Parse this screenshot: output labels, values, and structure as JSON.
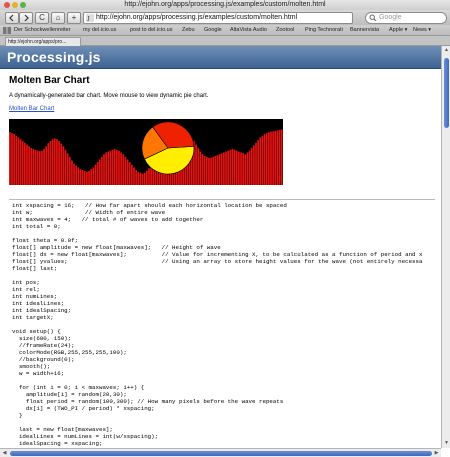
{
  "window": {
    "title": "http://ejohn.org/apps/processing.js/examples/custom/molten.html"
  },
  "toolbar": {
    "back_icon": "back-arrow-icon",
    "forward_icon": "forward-arrow-icon",
    "reload_label": "C",
    "home_label": "⌂",
    "add_label": "+",
    "url": "http://ejohn.org/apps/processing.js/examples/custom/molten.html",
    "search_placeholder": "Google"
  },
  "bookmarks": [
    "Der Schockwellenreiter",
    "my del.icio.us",
    "post to del.icio.us",
    "Zebu",
    "Google",
    "AltaVista Audio",
    "Zootool",
    "Ping Technorati",
    "Bannervista",
    "Apple ▾",
    "News ▾"
  ],
  "tab": {
    "label": "http://ejohn.org/apps/pro..."
  },
  "page": {
    "site_title": "Processing.js",
    "heading": "Molten Bar Chart",
    "description": "A dynamically-generated bar chart. Move mouse to view dynamic pie chart.",
    "link": "Molten Bar Chart",
    "code_lines": [
      "int xspacing = 16;   // How far apart should each horizontal location be spaced",
      "int w;               // Width of entire wave",
      "int maxwaves = 4;   // total # of waves to add together",
      "int total = 0;",
      "",
      "float theta = 0.0f;",
      "float[] amplitude = new float[maxwaves];   // Height of wave",
      "float[] dx = new float[maxwaves];          // Value for incrementing X, to be calculated as a function of period and x",
      "float[] yvalues;                           // Using an array to store height values for the wave (not entirely necessa",
      "float[] last;",
      "",
      "int pos;",
      "int rel;",
      "int numLines;",
      "int idealLines;",
      "int idealSpacing;",
      "int targetX;",
      "",
      "void setup() {",
      "  size(600, 150);",
      "  //frameRate(24);",
      "  colorMode(RGB,255,255,255,100);",
      "  //background(0);",
      "  smooth();",
      "  w = width+16;",
      "",
      "  for (int i = 0; i < maxwaves; i++) {",
      "    amplitude[i] = random(20,30);",
      "    float period = random(100,300); // How many pixels before the wave repeats",
      "    dx[i] = (TWO_PI / period) * xspacing;",
      "  }",
      "",
      "  last = new float[maxwaves];",
      "  idealLines = numLines = int(w/xspacing);",
      "  idealSpacing = xspacing;"
    ]
  },
  "chart_data": {
    "type": "bar",
    "bar_color": "#ee1111",
    "background": "#000000",
    "values": [
      120,
      118,
      116,
      112,
      108,
      104,
      100,
      96,
      92,
      88,
      84,
      82,
      80,
      78,
      77,
      78,
      82,
      88,
      95,
      100,
      104,
      106,
      104,
      100,
      94,
      88,
      80,
      72,
      64,
      56,
      48,
      44,
      40,
      36,
      34,
      32,
      30,
      32,
      36,
      40,
      46,
      52,
      58,
      64,
      70,
      74,
      76,
      78,
      80,
      82,
      80,
      78,
      74,
      70,
      64,
      58,
      52,
      46,
      40,
      34,
      30,
      28,
      26,
      28,
      32,
      38,
      44,
      50,
      56,
      62,
      68,
      74,
      80,
      86,
      92,
      98,
      104,
      110,
      116,
      120,
      124,
      126,
      124,
      120,
      114,
      108,
      100,
      92,
      84,
      76,
      70,
      66,
      64,
      62,
      62,
      64,
      66,
      68,
      70,
      72,
      74,
      76,
      78,
      80,
      82,
      80,
      78,
      76,
      74,
      72,
      70,
      74,
      78,
      84,
      90,
      96,
      102,
      108,
      112,
      116,
      118,
      120,
      121,
      122,
      123,
      124,
      125,
      126
    ],
    "ylim": [
      0,
      150
    ],
    "pie": {
      "slices": [
        {
          "value": 44,
          "color": "#ffee00"
        },
        {
          "value": 22,
          "color": "#ff7700"
        },
        {
          "value": 34,
          "color": "#ee2200"
        }
      ]
    }
  }
}
